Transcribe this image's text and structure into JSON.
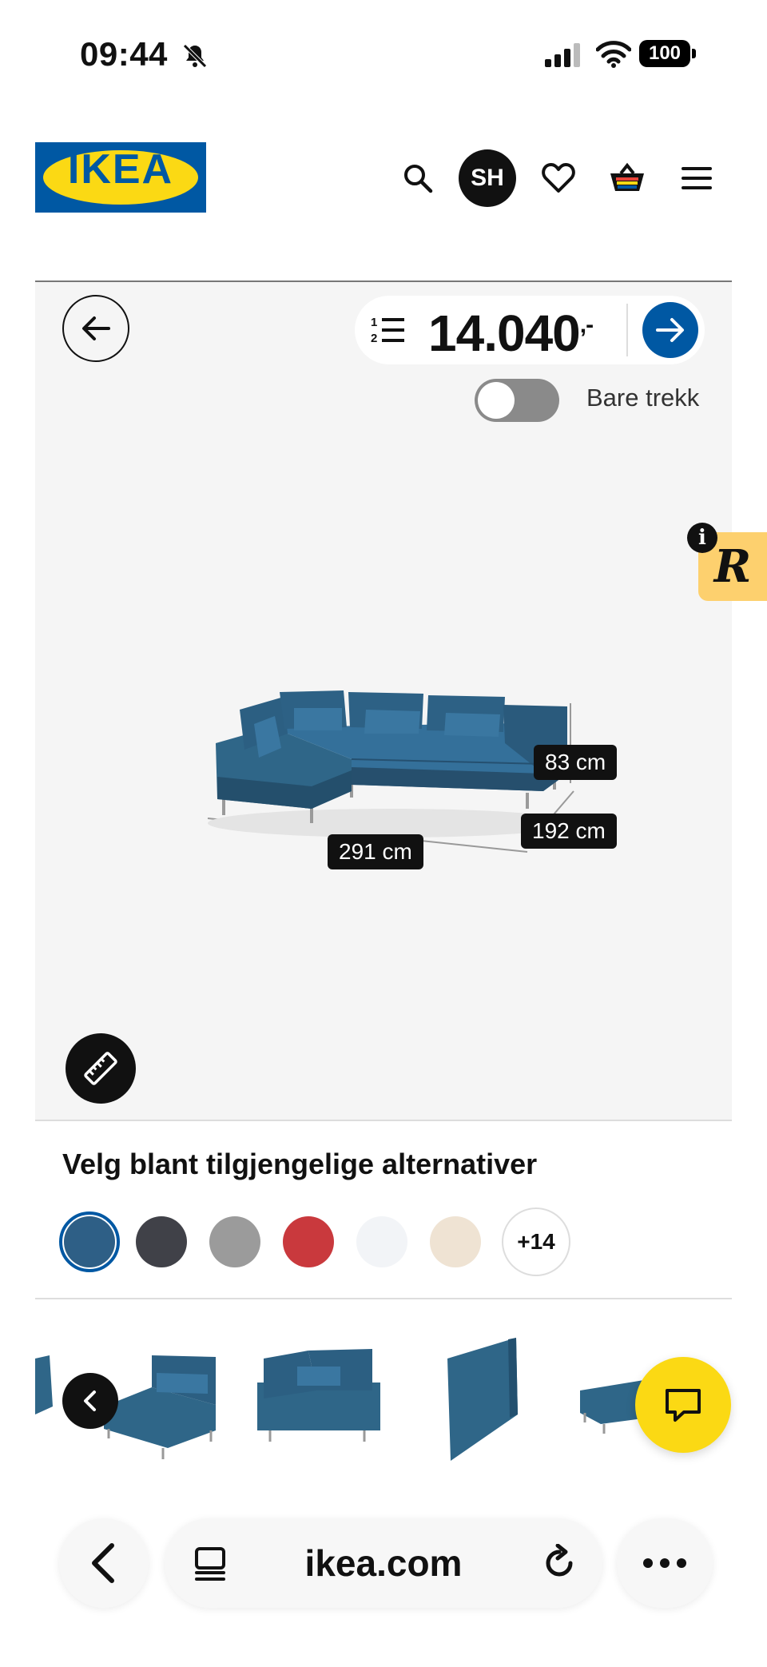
{
  "status_bar": {
    "time": "09:44",
    "battery": "100"
  },
  "header": {
    "logo_text": "IKEA",
    "avatar_initials": "SH"
  },
  "viewer": {
    "price": "14.040",
    "price_suffix": ",-",
    "toggle_label": "Bare trekk",
    "toggle_on": false,
    "dimensions": {
      "height": "83 cm",
      "depth": "192 cm",
      "width": "291 cm"
    },
    "badge_letter": "R",
    "info_letter": "i"
  },
  "options": {
    "title": "Velg blant tilgjengelige alternativer",
    "swatches": [
      "#2e5f86",
      "#404148",
      "#9b9b9b",
      "#c9393d",
      "#f2f4f7",
      "#efe3d3"
    ],
    "selected_index": 0,
    "more_label": "+14"
  },
  "browser": {
    "url": "ikea.com"
  },
  "colors": {
    "ikea_blue": "#0058a3",
    "ikea_yellow": "#fbd914",
    "sofa_blue": "#2f6688"
  }
}
